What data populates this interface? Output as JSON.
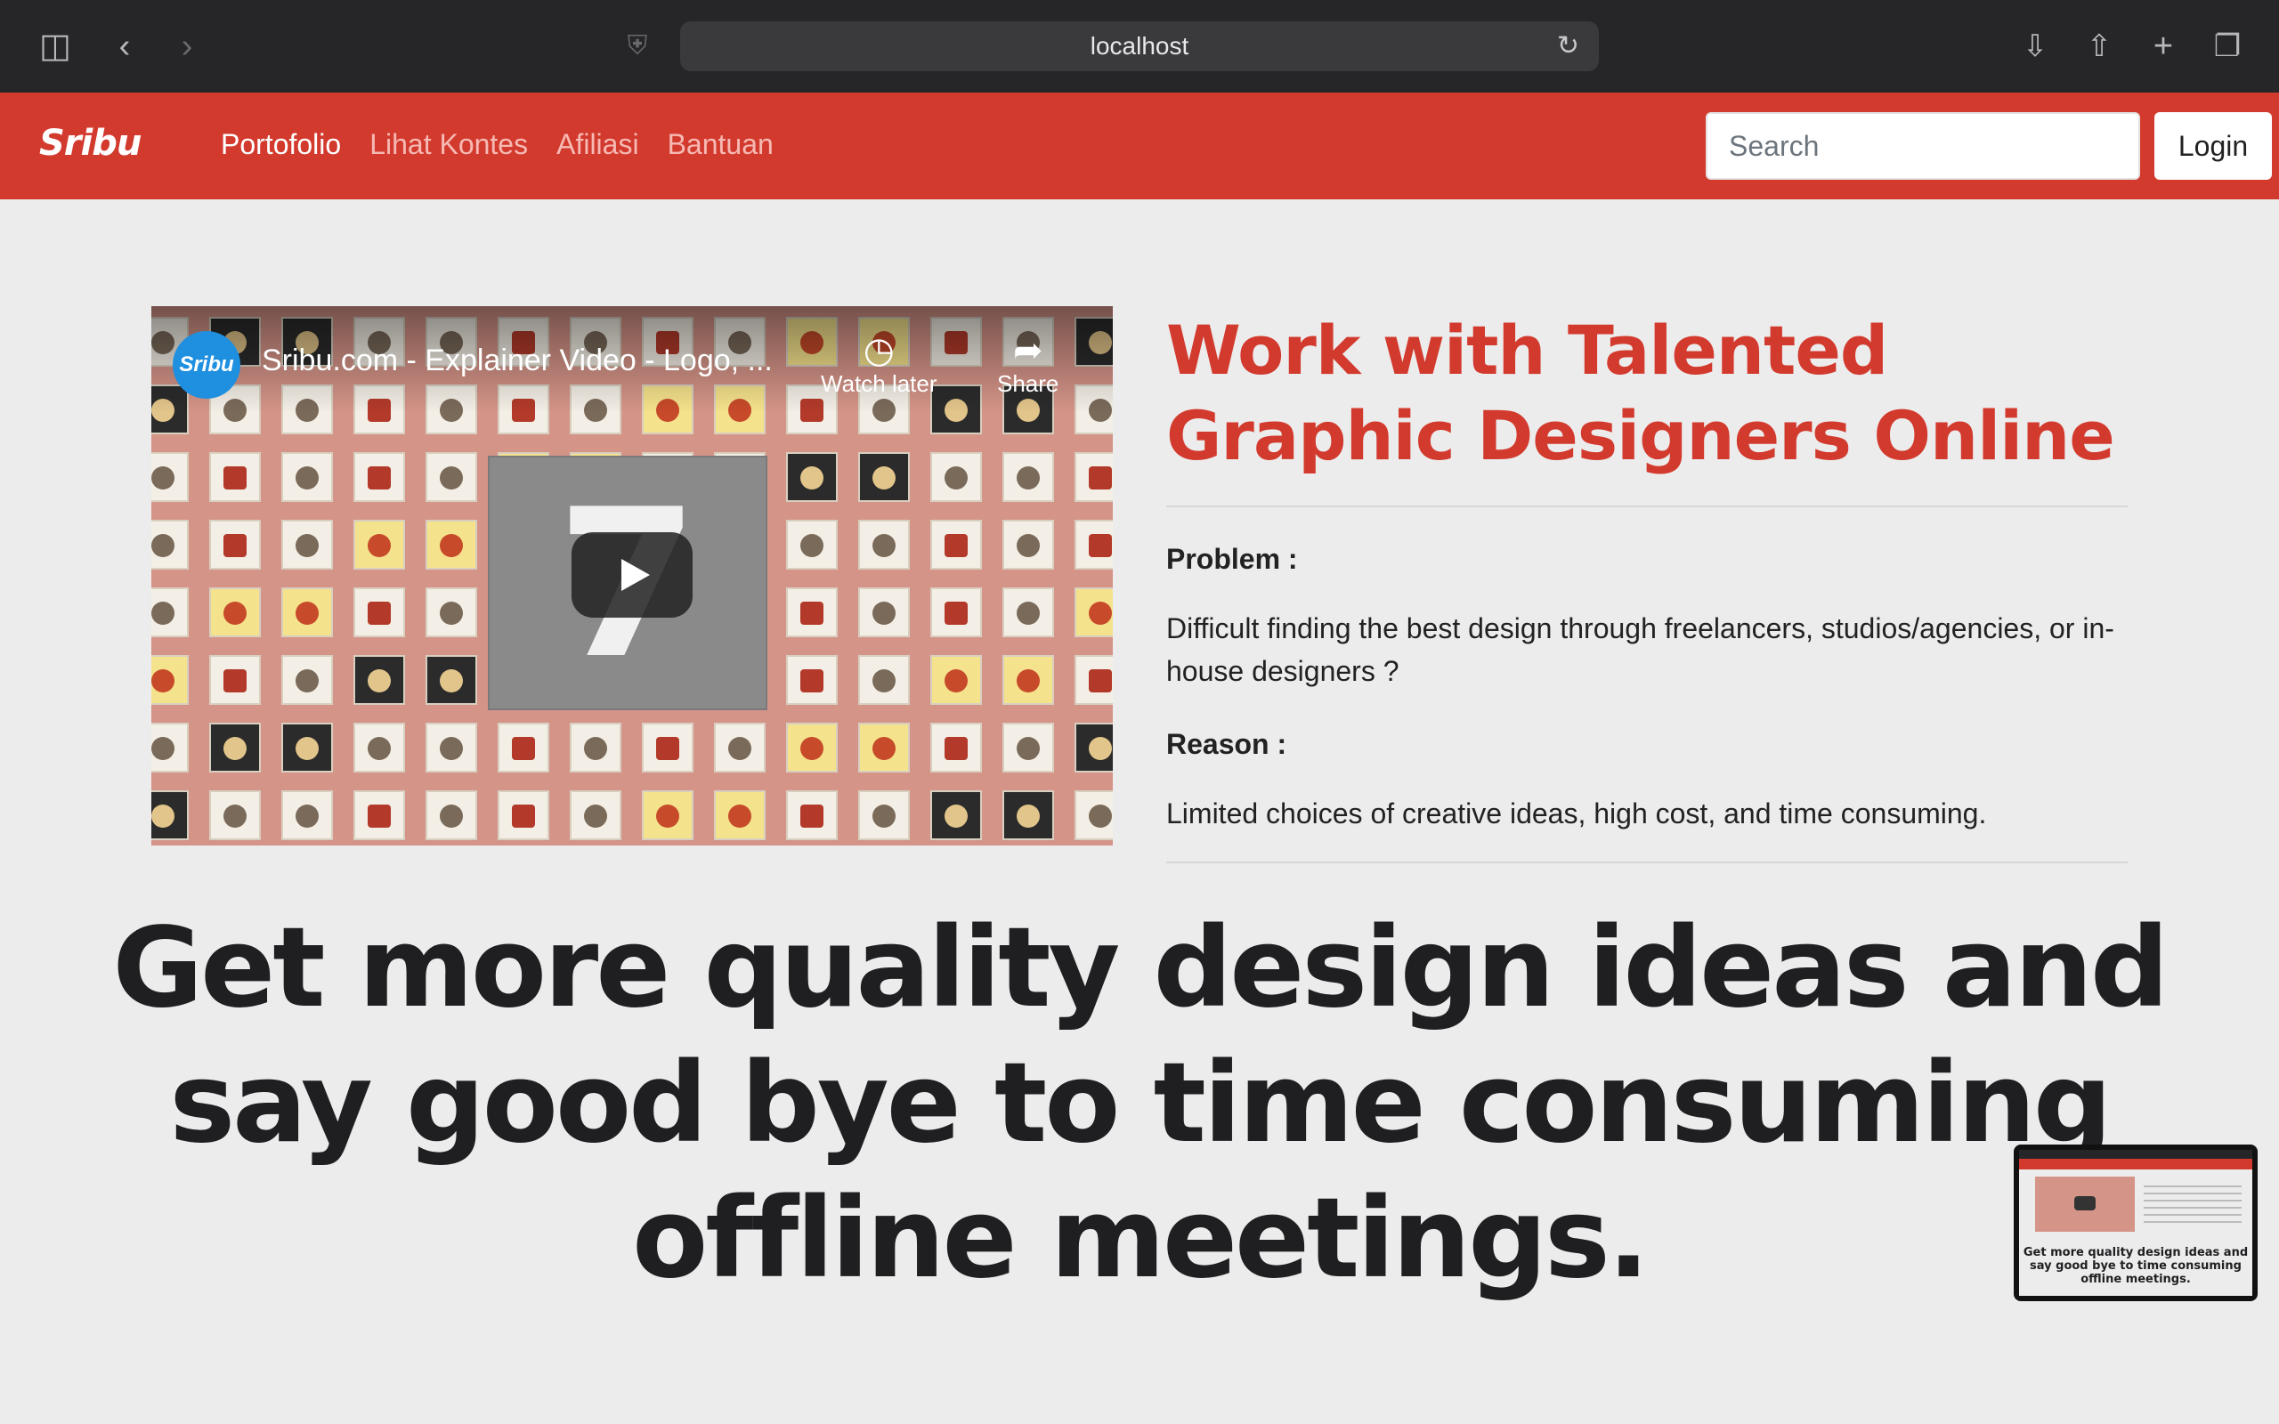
{
  "browser": {
    "url": "localhost"
  },
  "nav": {
    "logo": "Sribu",
    "links": [
      "Portofolio",
      "Lihat Kontes",
      "Afiliasi",
      "Bantuan"
    ],
    "search_placeholder": "Search",
    "login_label": "Login"
  },
  "video": {
    "channel": "Sribu",
    "title": "Sribu.com - Explainer Video - Logo, ...",
    "watch_later": "Watch later",
    "share": "Share",
    "panel_number": "7"
  },
  "hero": {
    "heading": "Work with Talented Graphic Designers Online",
    "problem_label": "Problem :",
    "problem_text": "Difficult finding the best design through freelancers, studios/agencies, or in-house designers ?",
    "reason_label": "Reason :",
    "reason_text": "Limited choices of creative ideas, high cost, and time consuming."
  },
  "headline": "Get more quality design ideas and say good bye to time consuming offline meetings.",
  "thumbnail": {
    "text": "Get more quality design ideas and say good bye to time consuming offline meetings."
  },
  "colors": {
    "brand_red": "#d33a2e",
    "chrome_dark": "#262628",
    "page_bg": "#ececec",
    "video_bg": "#d59488"
  },
  "icons": [
    "sidebar-icon",
    "back-icon",
    "forward-icon",
    "shield-icon",
    "reload-icon",
    "download-icon",
    "share-icon",
    "new-tab-icon",
    "tabs-overview-icon",
    "clock-icon",
    "play-icon"
  ]
}
